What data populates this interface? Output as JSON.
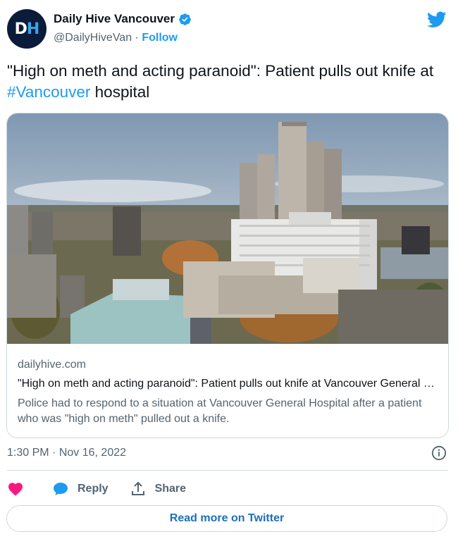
{
  "author": {
    "display_name": "Daily Hive Vancouver",
    "handle": "@DailyHiveVan",
    "separator": "·",
    "follow_label": "Follow",
    "avatar_initials": "DH"
  },
  "icons": {
    "brand": "twitter-bird-icon",
    "verified": "verified-badge-icon",
    "info": "info-icon",
    "like": "heart-icon",
    "reply": "speech-bubble-icon",
    "share": "share-icon"
  },
  "tweet": {
    "text_before": "\"High on meth and acting paranoid\": Patient pulls out knife at ",
    "hashtag": "#Vancouver",
    "text_after": " hospital"
  },
  "card": {
    "domain": "dailyhive.com",
    "title": "\"High on meth and acting paranoid\": Patient pulls out knife at Vancouver General Hospital",
    "description": "Police had to respond to a situation at Vancouver General Hospital after a patient who was \"high on meth\" pulled out a knife."
  },
  "timestamp": {
    "time": "1:30 PM",
    "separator": "·",
    "date": "Nov 16, 2022"
  },
  "actions": {
    "reply_label": "Reply",
    "share_label": "Share"
  },
  "read_more_label": "Read more on Twitter",
  "colors": {
    "accent": "#1d9bf0",
    "like": "#f91880",
    "reply": "#1d9bf0",
    "muted": "#536471",
    "border": "#cfd9de"
  }
}
